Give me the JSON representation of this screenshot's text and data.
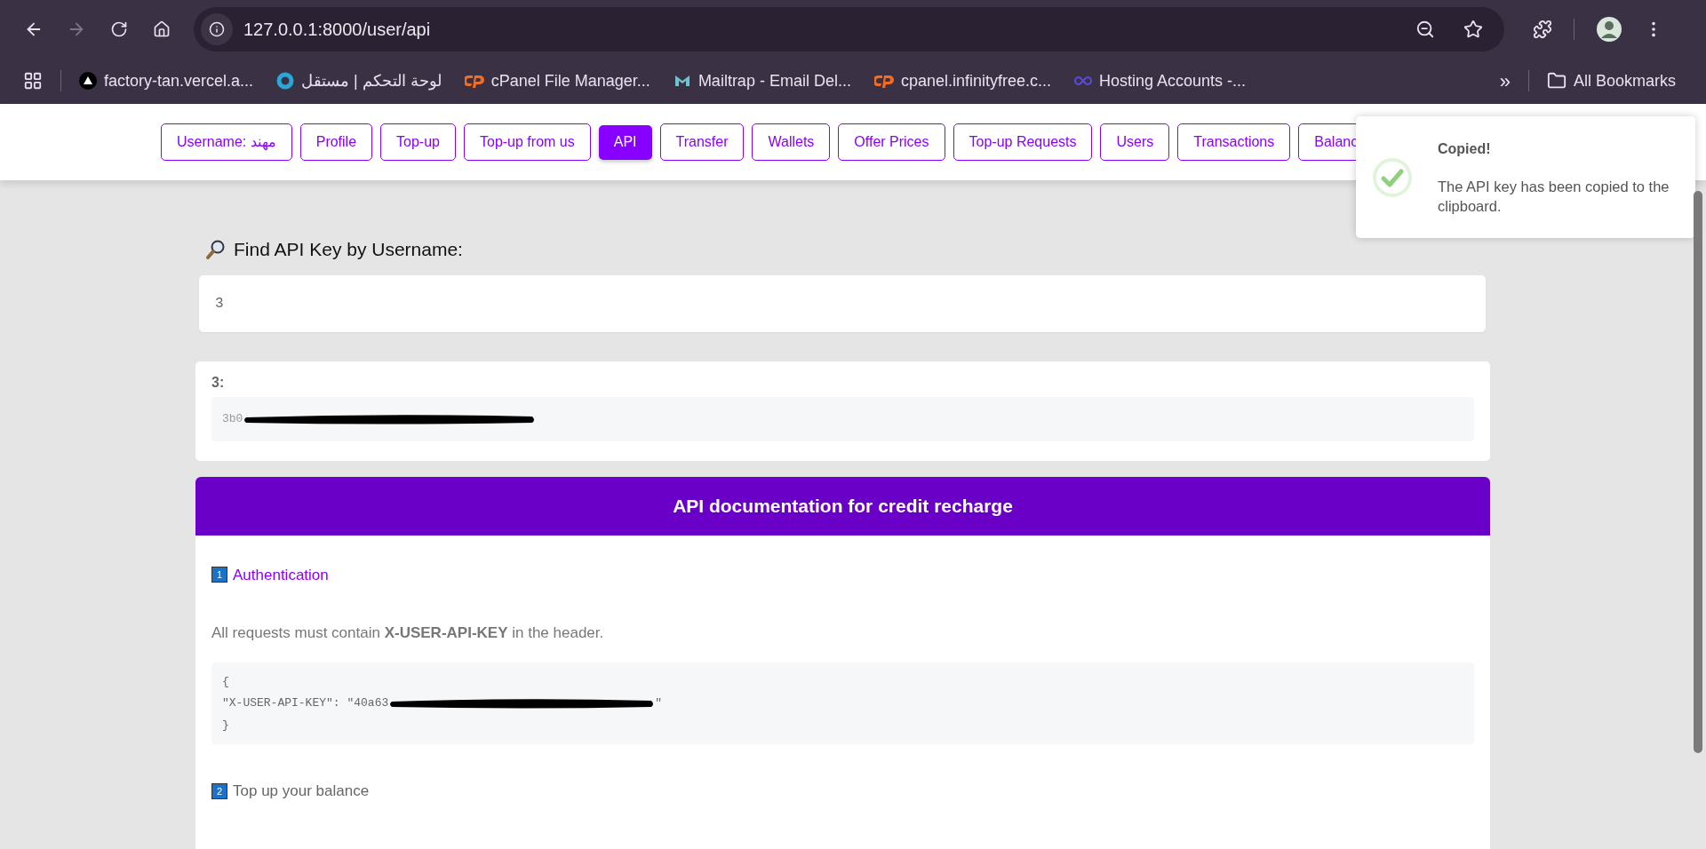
{
  "browser": {
    "url": "127.0.0.1:8000/user/api",
    "bookmarks": [
      {
        "label": "factory-tan.vercel.a..."
      },
      {
        "label": "لوحة التحكم | مستقل"
      },
      {
        "label": "cPanel File Manager..."
      },
      {
        "label": "Mailtrap - Email Del..."
      },
      {
        "label": "cpanel.infinityfree.c..."
      },
      {
        "label": "Hosting Accounts -..."
      }
    ],
    "more": "»",
    "all_bookmarks": "All Bookmarks"
  },
  "nav": [
    {
      "label": "Username: مهند",
      "selected": false
    },
    {
      "label": "Profile",
      "selected": false
    },
    {
      "label": "Top-up",
      "selected": false
    },
    {
      "label": "Top-up from us",
      "selected": false
    },
    {
      "label": "API",
      "selected": true
    },
    {
      "label": "Transfer",
      "selected": false
    },
    {
      "label": "Wallets",
      "selected": false
    },
    {
      "label": "Offer Prices",
      "selected": false
    },
    {
      "label": "Top-up Requests",
      "selected": false
    },
    {
      "label": "Users",
      "selected": false
    },
    {
      "label": "Transactions",
      "selected": false
    },
    {
      "label": "Balanc",
      "selected": false
    }
  ],
  "toast": {
    "title": "Copied!",
    "message": "The API key has been copied to the clipboard."
  },
  "finder": {
    "heading": "Find API Key by Username:",
    "value": "3"
  },
  "result": {
    "label": "3:",
    "key_prefix": "3b0"
  },
  "docs": {
    "title": "API documentation for credit recharge",
    "sections": [
      {
        "number": "1",
        "title": "Authentication",
        "selected": true,
        "paragraph": "All requests must contain **X-USER-API-KEY** in the header.",
        "code": [
          {
            "kind": "plain",
            "text": "{"
          },
          {
            "kind": "masked",
            "text": "\"X-USER-API-KEY\": \"40a63",
            "suffix": "\""
          },
          {
            "kind": "plain",
            "text": "}"
          }
        ]
      },
      {
        "number": "2",
        "title": "Top up your balance",
        "selected": false
      }
    ]
  }
}
